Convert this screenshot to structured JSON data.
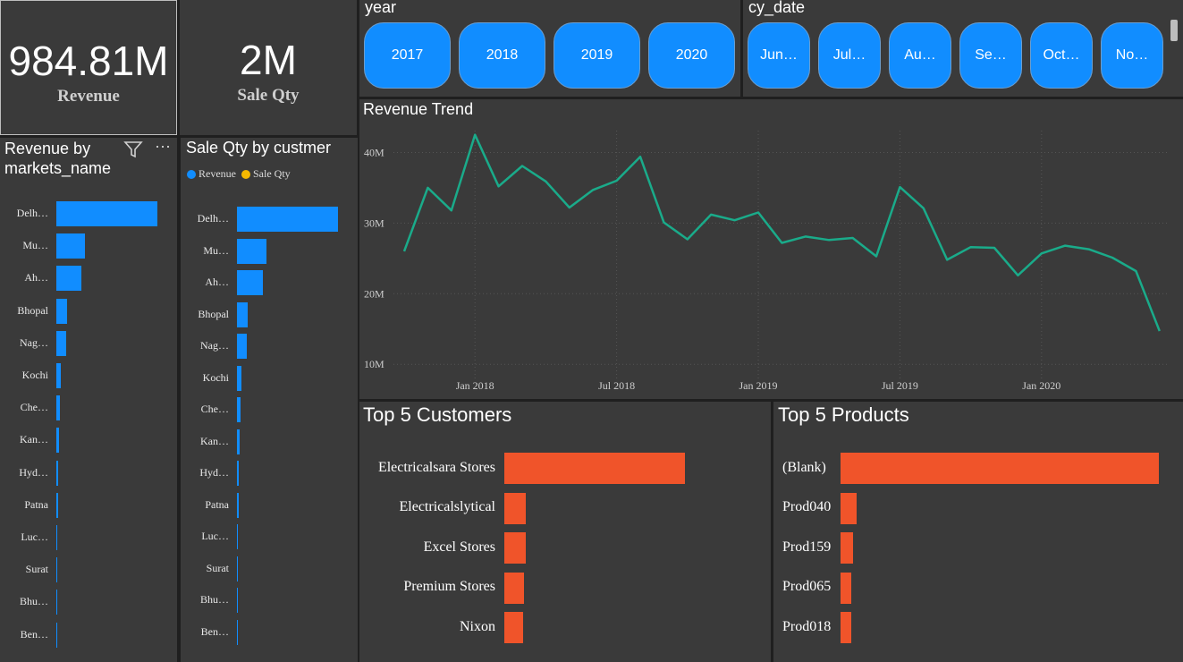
{
  "kpis": {
    "revenue": {
      "value": "984.81M",
      "label": "Revenue"
    },
    "sale_qty": {
      "value": "2M",
      "label": "Sale Qty"
    }
  },
  "year_slicer": {
    "title": "year",
    "options": [
      "2017",
      "2018",
      "2019",
      "2020"
    ]
  },
  "date_slicer": {
    "title": "cy_date",
    "options": [
      "Jun…",
      "Jul…",
      "Au…",
      "Se…",
      "Oct…",
      "No…"
    ]
  },
  "revenue_by_market": {
    "title": "Revenue by markets_name",
    "categories": [
      "Delh…",
      "Mu…",
      "Ah…",
      "Bhopal",
      "Nag…",
      "Kochi",
      "Che…",
      "Kan…",
      "Hyd…",
      "Patna",
      "Luc…",
      "Surat",
      "Bhu…",
      "Ben…"
    ],
    "values": [
      100,
      28,
      25,
      11,
      10,
      4,
      3.5,
      3,
      2,
      1.5,
      1.2,
      1,
      0.5,
      0.3
    ]
  },
  "sale_qty_by_customer": {
    "title": "Sale Qty by custmer",
    "legend": [
      {
        "name": "Revenue",
        "color": "#118dff"
      },
      {
        "name": "Sale Qty",
        "color": "#f5b800"
      }
    ],
    "categories": [
      "Delh…",
      "Mu…",
      "Ah…",
      "Bhopal",
      "Nag…",
      "Kochi",
      "Che…",
      "Kan…",
      "Hyd…",
      "Patna",
      "Luc…",
      "Surat",
      "Bhu…",
      "Ben…"
    ],
    "values": [
      100,
      29,
      26,
      11,
      10,
      4,
      3.5,
      3,
      2,
      1.5,
      1.2,
      1,
      0.5,
      0.3
    ]
  },
  "chart_data": {
    "type": "line",
    "title": "Revenue Trend",
    "x": [
      "2017-10",
      "2017-11",
      "2017-12",
      "2018-01",
      "2018-02",
      "2018-03",
      "2018-04",
      "2018-05",
      "2018-06",
      "2018-07",
      "2018-08",
      "2018-09",
      "2018-10",
      "2018-11",
      "2018-12",
      "2019-01",
      "2019-02",
      "2019-03",
      "2019-04",
      "2019-05",
      "2019-06",
      "2019-07",
      "2019-08",
      "2019-09",
      "2019-10",
      "2019-11",
      "2019-12",
      "2020-01",
      "2020-02",
      "2020-03",
      "2020-04",
      "2020-05",
      "2020-06"
    ],
    "series": [
      {
        "values": [
          26,
          35,
          31.8,
          42.5,
          35.2,
          38.1,
          35.9,
          32.2,
          34.7,
          36,
          39.4,
          30.1,
          27.7,
          31.2,
          30.4,
          31.5,
          27.2,
          28.1,
          27.6,
          27.9,
          25.3,
          35.1,
          32.1,
          24.8,
          26.6,
          26.5,
          22.6,
          25.7,
          26.8,
          26.3,
          25.1,
          23.2,
          14.7
        ]
      }
    ],
    "x_tick_labels": [
      "Jan 2018",
      "Jul 2018",
      "Jan 2019",
      "Jul 2019",
      "Jan 2020"
    ],
    "y_tick_labels": [
      "10M",
      "20M",
      "30M",
      "40M"
    ],
    "ylim": [
      8,
      45
    ],
    "line_color": "#1aab8a",
    "grid": true
  },
  "top_customers": {
    "title": "Top 5 Customers",
    "categories": [
      "Electricalsara Stores",
      "Electricalslytical",
      "Excel Stores",
      "Premium Stores",
      "Nixon"
    ],
    "values": [
      100,
      12,
      12,
      11,
      10.5
    ]
  },
  "top_products": {
    "title": "Top 5 Products",
    "categories": [
      "(Blank)",
      "Prod040",
      "Prod159",
      "Prod065",
      "Prod018"
    ],
    "values": [
      100,
      5,
      4,
      3.5,
      3.3
    ]
  },
  "colors": {
    "accent_blue": "#118dff",
    "bar_orange": "#f0542a",
    "line_teal": "#1aab8a",
    "panel_bg": "#3a3a3a"
  },
  "icons": [
    "filter-icon",
    "more-options-icon"
  ]
}
